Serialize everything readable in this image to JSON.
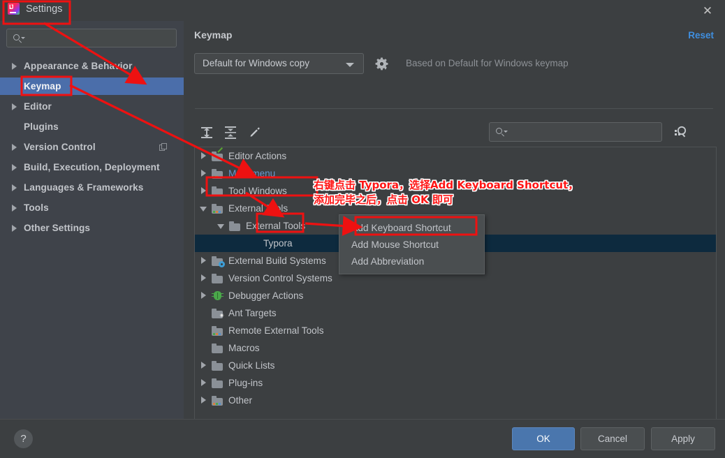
{
  "window": {
    "title": "Settings",
    "logo_icon": "intellij-idea-logo",
    "close_icon": "close-icon"
  },
  "sidebar": {
    "search": {
      "value": "",
      "placeholder": "",
      "icon": "search-icon"
    },
    "items": [
      {
        "label": "Appearance & Behavior",
        "expandable": true,
        "selected": false,
        "extra_icon": ""
      },
      {
        "label": "Keymap",
        "expandable": false,
        "selected": true,
        "extra_icon": ""
      },
      {
        "label": "Editor",
        "expandable": true,
        "selected": false,
        "extra_icon": ""
      },
      {
        "label": "Plugins",
        "expandable": false,
        "selected": false,
        "extra_icon": ""
      },
      {
        "label": "Version Control",
        "expandable": true,
        "selected": false,
        "extra_icon": "copy-icon"
      },
      {
        "label": "Build, Execution, Deployment",
        "expandable": true,
        "selected": false,
        "extra_icon": ""
      },
      {
        "label": "Languages & Frameworks",
        "expandable": true,
        "selected": false,
        "extra_icon": ""
      },
      {
        "label": "Tools",
        "expandable": true,
        "selected": false,
        "extra_icon": ""
      },
      {
        "label": "Other Settings",
        "expandable": true,
        "selected": false,
        "extra_icon": ""
      }
    ]
  },
  "main": {
    "page_title": "Keymap",
    "reset_label": "Reset",
    "keymap_combo": {
      "value": "Default for Windows copy",
      "icon": "chevron-down-icon"
    },
    "gear_icon": "gear-icon",
    "based_on_text": "Based on Default for Windows keymap",
    "toolbar": {
      "expand_all_icon": "expand-all-icon",
      "collapse_all_icon": "collapse-all-icon",
      "edit_icon": "pencil-edit-icon",
      "filter_icon": "find-shortcut-icon"
    },
    "tree_search": {
      "value": "",
      "placeholder": "",
      "icon": "search-icon"
    },
    "tree": [
      {
        "label": "Editor Actions",
        "indent": 0,
        "toggle": "right",
        "icon": "folder-editor-actions",
        "selected": false,
        "blue": false
      },
      {
        "label": "Main menu",
        "indent": 0,
        "toggle": "right",
        "icon": "folder-main-menu",
        "selected": false,
        "blue": true
      },
      {
        "label": "Tool Windows",
        "indent": 0,
        "toggle": "right",
        "icon": "folder-plain",
        "selected": false,
        "blue": false
      },
      {
        "label": "External Tools",
        "indent": 0,
        "toggle": "down",
        "icon": "folder-external-tools",
        "selected": false,
        "blue": false
      },
      {
        "label": "External Tools",
        "indent": 1,
        "toggle": "down",
        "icon": "folder-plain",
        "selected": false,
        "blue": false
      },
      {
        "label": "Typora",
        "indent": 2,
        "toggle": "none",
        "icon": "none",
        "selected": true,
        "blue": false
      },
      {
        "label": "External Build Systems",
        "indent": 0,
        "toggle": "right",
        "icon": "folder-gear",
        "selected": false,
        "blue": false
      },
      {
        "label": "Version Control Systems",
        "indent": 0,
        "toggle": "right",
        "icon": "folder-plain",
        "selected": false,
        "blue": false
      },
      {
        "label": "Debugger Actions",
        "indent": 0,
        "toggle": "right",
        "icon": "bug-icon",
        "selected": false,
        "blue": false
      },
      {
        "label": "Ant Targets",
        "indent": 0,
        "toggle": "none",
        "icon": "folder-ant",
        "selected": false,
        "blue": false
      },
      {
        "label": "Remote External Tools",
        "indent": 0,
        "toggle": "none",
        "icon": "folder-external-tools",
        "selected": false,
        "blue": false
      },
      {
        "label": "Macros",
        "indent": 0,
        "toggle": "none",
        "icon": "folder-plain",
        "selected": false,
        "blue": false
      },
      {
        "label": "Quick Lists",
        "indent": 0,
        "toggle": "right",
        "icon": "folder-plain",
        "selected": false,
        "blue": false
      },
      {
        "label": "Plug-ins",
        "indent": 0,
        "toggle": "right",
        "icon": "folder-plain",
        "selected": false,
        "blue": false
      },
      {
        "label": "Other",
        "indent": 0,
        "toggle": "right",
        "icon": "folder-other",
        "selected": false,
        "blue": false
      }
    ]
  },
  "context_menu": {
    "items": [
      {
        "label": "Add Keyboard Shortcut",
        "highlighted": true
      },
      {
        "label": "Add Mouse Shortcut",
        "highlighted": false
      },
      {
        "label": "Add Abbreviation",
        "highlighted": false
      }
    ]
  },
  "footer": {
    "help_icon": "help-question-icon",
    "ok_label": "OK",
    "cancel_label": "Cancel",
    "apply_label": "Apply"
  },
  "annotation": {
    "color": "#ff1515",
    "line1": "右键点击 Typora，选择Add Keyboard Shortcut，",
    "line2": "添加完毕之后，点击 OK 即可"
  }
}
